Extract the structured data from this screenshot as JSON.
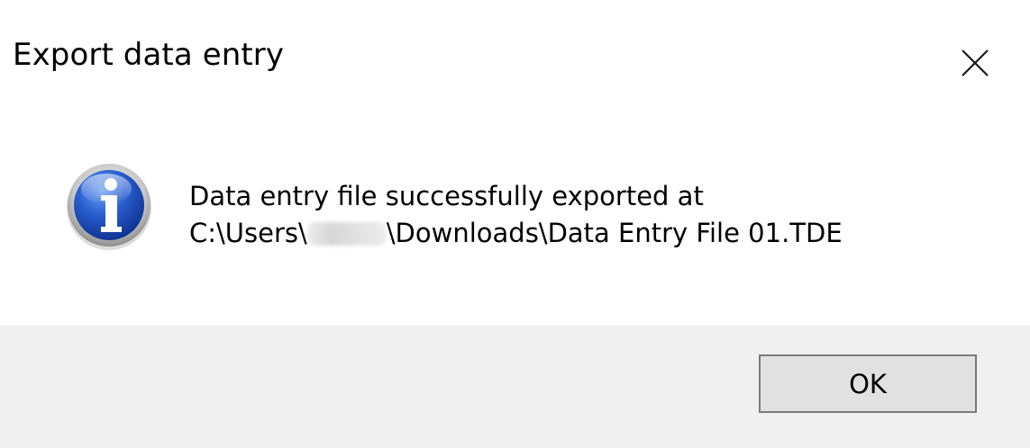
{
  "dialog": {
    "title": "Export data entry",
    "message_line1": "Data entry file successfully exported at",
    "message_line2_prefix": "C:\\Users\\",
    "message_line2_suffix": "\\Downloads\\Data Entry File 01.TDE",
    "icon": "info-icon",
    "ok_label": "OK"
  },
  "colors": {
    "background": "#ffffff",
    "footer": "#f0f0f0",
    "button_bg": "#e1e1e1",
    "button_border": "#7a7a7a",
    "icon_blue": "#1f4fbf"
  }
}
